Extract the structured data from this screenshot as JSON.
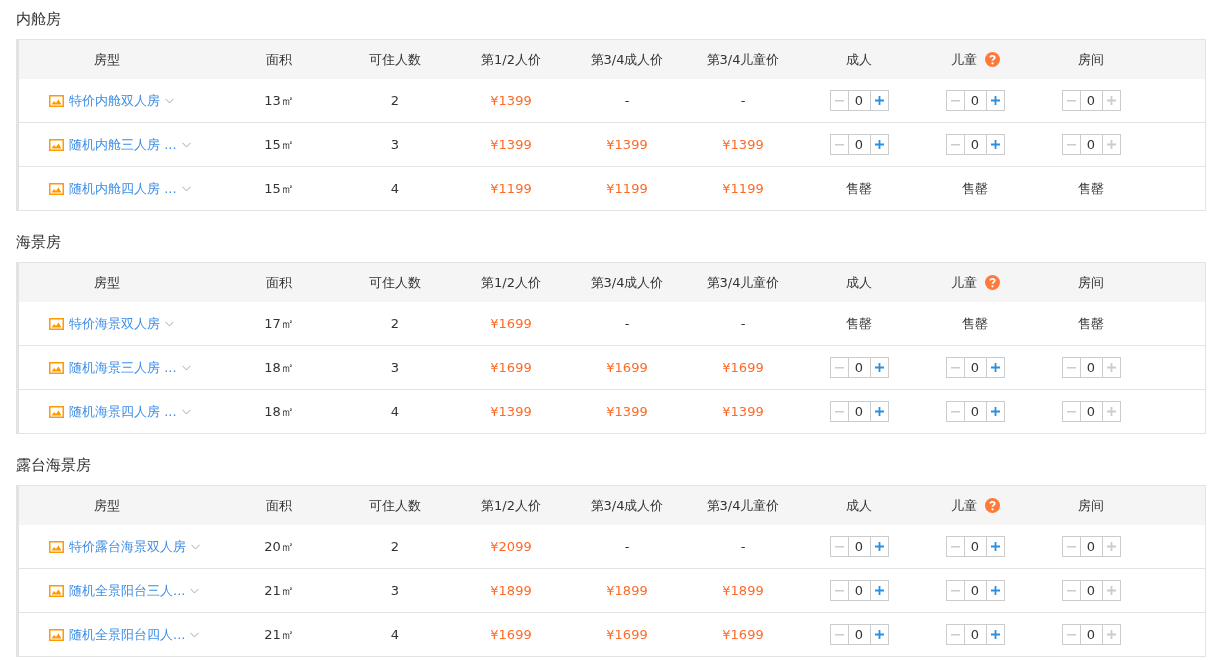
{
  "sections": [
    {
      "title": "内舱房",
      "columns": [
        "房型",
        "面积",
        "可住人数",
        "第1/2人价",
        "第3/4成人价",
        "第3/4儿童价",
        "成人",
        "儿童",
        "房间"
      ],
      "rows": [
        {
          "name": "特价内舱双人房",
          "area": "13㎡",
          "capacity": "2",
          "price_12": "¥1399",
          "price_34_adult": "-",
          "price_34_child": "-",
          "counters": [
            {
              "kind": "stepper",
              "value": "0",
              "plus_enabled": true
            },
            {
              "kind": "stepper",
              "value": "0",
              "plus_enabled": true
            },
            {
              "kind": "stepper",
              "value": "0",
              "plus_enabled": false
            }
          ]
        },
        {
          "name": "随机内舱三人房 ...",
          "area": "15㎡",
          "capacity": "3",
          "price_12": "¥1399",
          "price_34_adult": "¥1399",
          "price_34_child": "¥1399",
          "counters": [
            {
              "kind": "stepper",
              "value": "0",
              "plus_enabled": true
            },
            {
              "kind": "stepper",
              "value": "0",
              "plus_enabled": true
            },
            {
              "kind": "stepper",
              "value": "0",
              "plus_enabled": false
            }
          ]
        },
        {
          "name": "随机内舱四人房 ...",
          "area": "15㎡",
          "capacity": "4",
          "price_12": "¥1199",
          "price_34_adult": "¥1199",
          "price_34_child": "¥1199",
          "counters": [
            {
              "kind": "sold_out",
              "text": "售罄"
            },
            {
              "kind": "sold_out",
              "text": "售罄"
            },
            {
              "kind": "sold_out",
              "text": "售罄"
            }
          ]
        }
      ]
    },
    {
      "title": "海景房",
      "columns": [
        "房型",
        "面积",
        "可住人数",
        "第1/2人价",
        "第3/4成人价",
        "第3/4儿童价",
        "成人",
        "儿童",
        "房间"
      ],
      "rows": [
        {
          "name": "特价海景双人房",
          "area": "17㎡",
          "capacity": "2",
          "price_12": "¥1699",
          "price_34_adult": "-",
          "price_34_child": "-",
          "counters": [
            {
              "kind": "sold_out",
              "text": "售罄"
            },
            {
              "kind": "sold_out",
              "text": "售罄"
            },
            {
              "kind": "sold_out",
              "text": "售罄"
            }
          ]
        },
        {
          "name": "随机海景三人房 ...",
          "area": "18㎡",
          "capacity": "3",
          "price_12": "¥1699",
          "price_34_adult": "¥1699",
          "price_34_child": "¥1699",
          "counters": [
            {
              "kind": "stepper",
              "value": "0",
              "plus_enabled": true
            },
            {
              "kind": "stepper",
              "value": "0",
              "plus_enabled": true
            },
            {
              "kind": "stepper",
              "value": "0",
              "plus_enabled": false
            }
          ]
        },
        {
          "name": "随机海景四人房 ...",
          "area": "18㎡",
          "capacity": "4",
          "price_12": "¥1399",
          "price_34_adult": "¥1399",
          "price_34_child": "¥1399",
          "counters": [
            {
              "kind": "stepper",
              "value": "0",
              "plus_enabled": true
            },
            {
              "kind": "stepper",
              "value": "0",
              "plus_enabled": true
            },
            {
              "kind": "stepper",
              "value": "0",
              "plus_enabled": false
            }
          ]
        }
      ]
    },
    {
      "title": "露台海景房",
      "columns": [
        "房型",
        "面积",
        "可住人数",
        "第1/2人价",
        "第3/4成人价",
        "第3/4儿童价",
        "成人",
        "儿童",
        "房间"
      ],
      "rows": [
        {
          "name": "特价露台海景双人房",
          "area": "20㎡",
          "capacity": "2",
          "price_12": "¥2099",
          "price_34_adult": "-",
          "price_34_child": "-",
          "counters": [
            {
              "kind": "stepper",
              "value": "0",
              "plus_enabled": true
            },
            {
              "kind": "stepper",
              "value": "0",
              "plus_enabled": true
            },
            {
              "kind": "stepper",
              "value": "0",
              "plus_enabled": false
            }
          ]
        },
        {
          "name": "随机全景阳台三人...",
          "area": "21㎡",
          "capacity": "3",
          "price_12": "¥1899",
          "price_34_adult": "¥1899",
          "price_34_child": "¥1899",
          "counters": [
            {
              "kind": "stepper",
              "value": "0",
              "plus_enabled": true
            },
            {
              "kind": "stepper",
              "value": "0",
              "plus_enabled": true
            },
            {
              "kind": "stepper",
              "value": "0",
              "plus_enabled": false
            }
          ]
        },
        {
          "name": "随机全景阳台四人...",
          "area": "21㎡",
          "capacity": "4",
          "price_12": "¥1699",
          "price_34_adult": "¥1699",
          "price_34_child": "¥1699",
          "counters": [
            {
              "kind": "stepper",
              "value": "0",
              "plus_enabled": true
            },
            {
              "kind": "stepper",
              "value": "0",
              "plus_enabled": true
            },
            {
              "kind": "stepper",
              "value": "0",
              "plus_enabled": false
            }
          ]
        }
      ]
    }
  ]
}
